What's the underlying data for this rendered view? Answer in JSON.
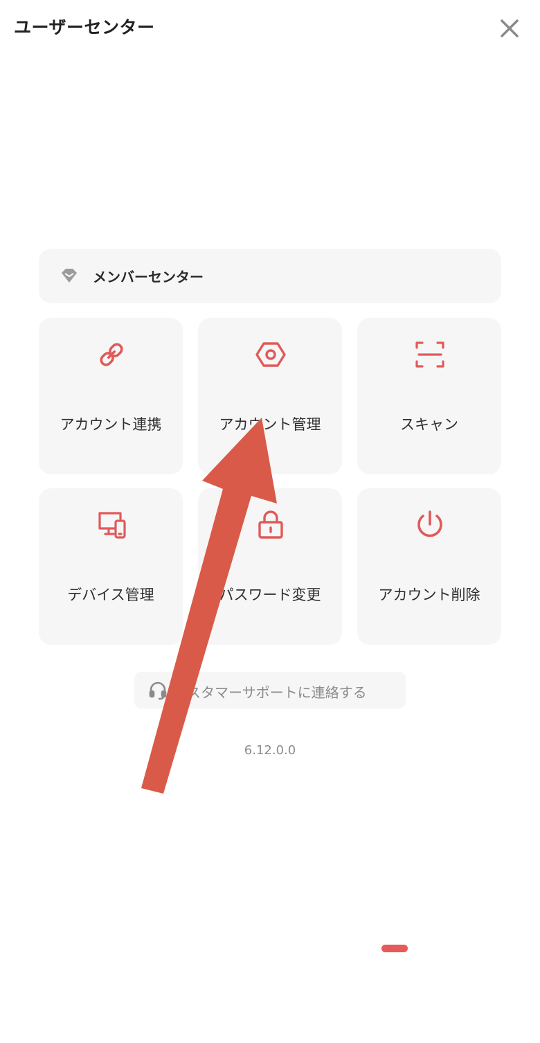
{
  "header": {
    "title": "ユーザーセンター",
    "close_icon": "close-icon"
  },
  "member_center": {
    "label": "メンバーセンター",
    "icon": "diamond-icon"
  },
  "grid": {
    "items": [
      {
        "label": "アカウント連携",
        "icon": "link-icon"
      },
      {
        "label": "アカウント管理",
        "icon": "hexagon-settings-icon"
      },
      {
        "label": "スキャン",
        "icon": "scan-icon"
      },
      {
        "label": "デバイス管理",
        "icon": "devices-icon"
      },
      {
        "label": "パスワード変更",
        "icon": "lock-icon"
      },
      {
        "label": "アカウント削除",
        "icon": "power-icon"
      }
    ]
  },
  "support": {
    "label": "カスタマーサポートに連絡する",
    "icon": "headset-icon"
  },
  "version": "6.12.0.0",
  "colors": {
    "accent": "#e05a5a",
    "arrow": "#d95a48",
    "card_bg": "#f6f6f6",
    "muted_text": "#8a8a8a"
  }
}
